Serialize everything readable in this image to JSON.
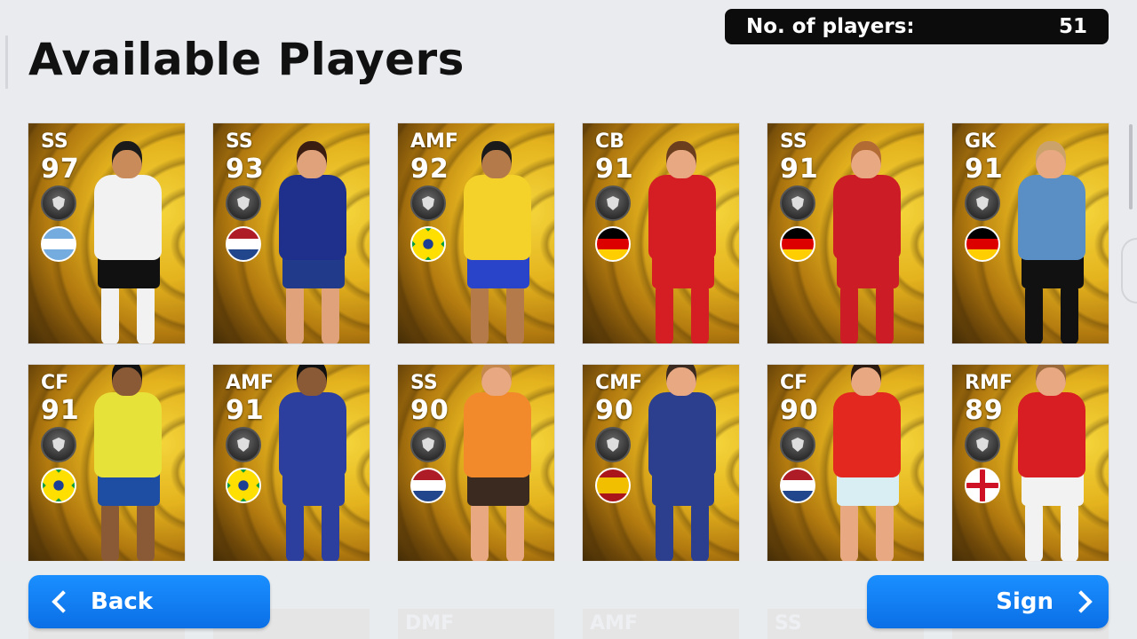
{
  "header": {
    "title": "Available Players",
    "count_label": "No. of players:",
    "count_value": "51"
  },
  "cards": [
    {
      "pos": "SS",
      "rating": "97",
      "flag": "argentina",
      "shirt": "#f2f2f2",
      "shorts": "#111111",
      "skin": "#c98b5a",
      "hair": "#1a1a1a",
      "legs": "#f2f2f2"
    },
    {
      "pos": "SS",
      "rating": "93",
      "flag": "netherlands",
      "shirt": "#1e2f8c",
      "shorts": "#223a8a",
      "skin": "#e0a27a",
      "hair": "#3a1c10",
      "legs": "#e0a27a"
    },
    {
      "pos": "AMF",
      "rating": "92",
      "flag": "brazil",
      "shirt": "#f4d22a",
      "shorts": "#2a44c9",
      "skin": "#b57a4a",
      "hair": "#1a1a1a",
      "legs": "#b57a4a"
    },
    {
      "pos": "CB",
      "rating": "91",
      "flag": "germany",
      "shirt": "#d51e24",
      "shorts": "#d51e24",
      "skin": "#e8a882",
      "hair": "#6b3f1d",
      "legs": "#d51e24"
    },
    {
      "pos": "SS",
      "rating": "91",
      "flag": "germany",
      "shirt": "#cc1d26",
      "shorts": "#cc1d26",
      "skin": "#e8a882",
      "hair": "#b36b34",
      "legs": "#cc1d26"
    },
    {
      "pos": "GK",
      "rating": "91",
      "flag": "germany",
      "shirt": "#5a8fc5",
      "shorts": "#111111",
      "skin": "#e8a882",
      "hair": "#caa26a",
      "legs": "#111111"
    },
    {
      "pos": "CF",
      "rating": "91",
      "flag": "brazil",
      "shirt": "#e7e23a",
      "shorts": "#1e4ea3",
      "skin": "#8a5a36",
      "hair": "#111111",
      "legs": "#8a5a36"
    },
    {
      "pos": "AMF",
      "rating": "91",
      "flag": "brazil",
      "shirt": "#2c3f9e",
      "shorts": "#2c3f9e",
      "skin": "#8a5a36",
      "hair": "#111111",
      "legs": "#2c3f9e"
    },
    {
      "pos": "SS",
      "rating": "90",
      "flag": "netherlands",
      "shirt": "#f28a2c",
      "shorts": "#3a2a20",
      "skin": "#e8a882",
      "hair": "#c4874c",
      "legs": "#e8a882"
    },
    {
      "pos": "CMF",
      "rating": "90",
      "flag": "spain",
      "shirt": "#2c3f8e",
      "shorts": "#2c3f8e",
      "skin": "#e8a882",
      "hair": "#3a2a20",
      "legs": "#2c3f8e"
    },
    {
      "pos": "CF",
      "rating": "90",
      "flag": "netherlands",
      "shirt": "#e3291f",
      "shorts": "#d8eef2",
      "skin": "#e8a882",
      "hair": "#2a1a10",
      "legs": "#e8a882"
    },
    {
      "pos": "RMF",
      "rating": "89",
      "flag": "england",
      "shirt": "#d81e22",
      "shorts": "#f2f2f2",
      "skin": "#e8a882",
      "hair": "#9a6a3a",
      "legs": "#f2f2f2"
    }
  ],
  "ghost_row": [
    "DMF",
    "AMF",
    "SS"
  ],
  "buttons": {
    "back_label": "Back",
    "sign_label": "Sign"
  }
}
